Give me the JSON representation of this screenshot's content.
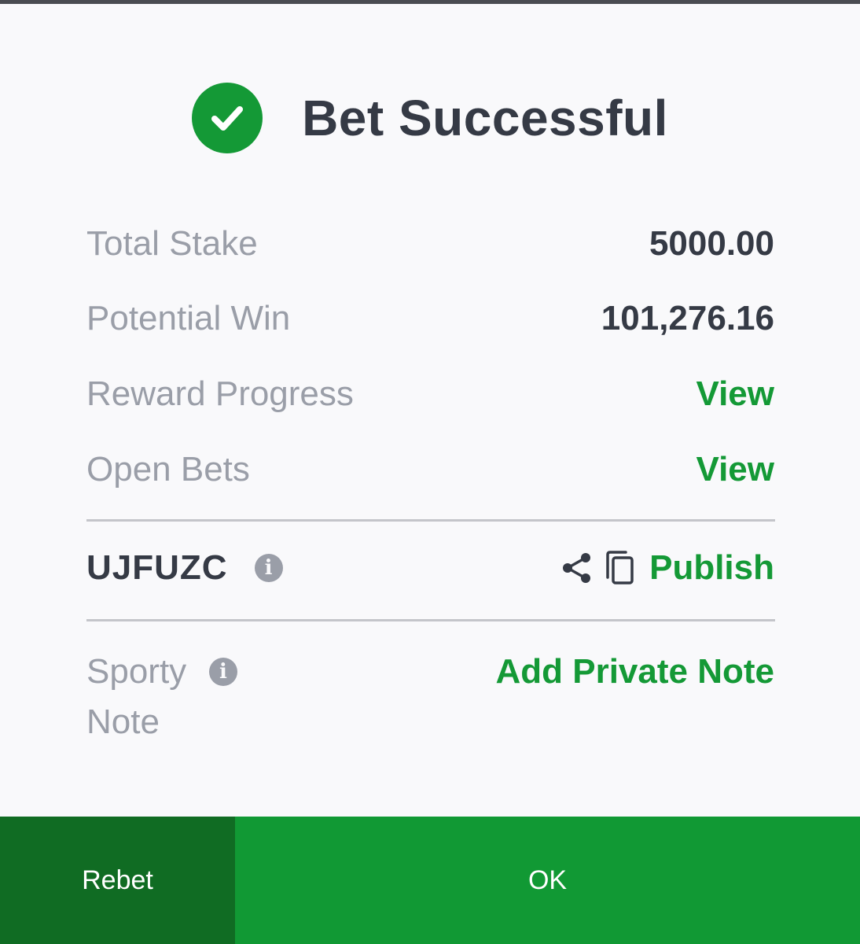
{
  "header": {
    "title": "Bet Successful",
    "icon": "check-circle-icon",
    "accent_color": "#149936"
  },
  "summary": {
    "total_stake": {
      "label": "Total Stake",
      "value": "5000.00"
    },
    "potential_win": {
      "label": "Potential Win",
      "value": "101,276.16"
    },
    "reward_progress": {
      "label": "Reward Progress",
      "link": "View"
    },
    "open_bets": {
      "label": "Open Bets",
      "link": "View"
    }
  },
  "booking": {
    "code": "UJFUZC",
    "info_icon": "info-icon",
    "share_icon": "share-icon",
    "copy_icon": "copy-icon",
    "publish_label": "Publish"
  },
  "note": {
    "label": "Sporty Note",
    "info_icon": "info-icon",
    "add_label": "Add Private Note"
  },
  "footer": {
    "rebet_label": "Rebet",
    "ok_label": "OK",
    "rebet_color": "#106c23",
    "ok_color": "#119934"
  }
}
